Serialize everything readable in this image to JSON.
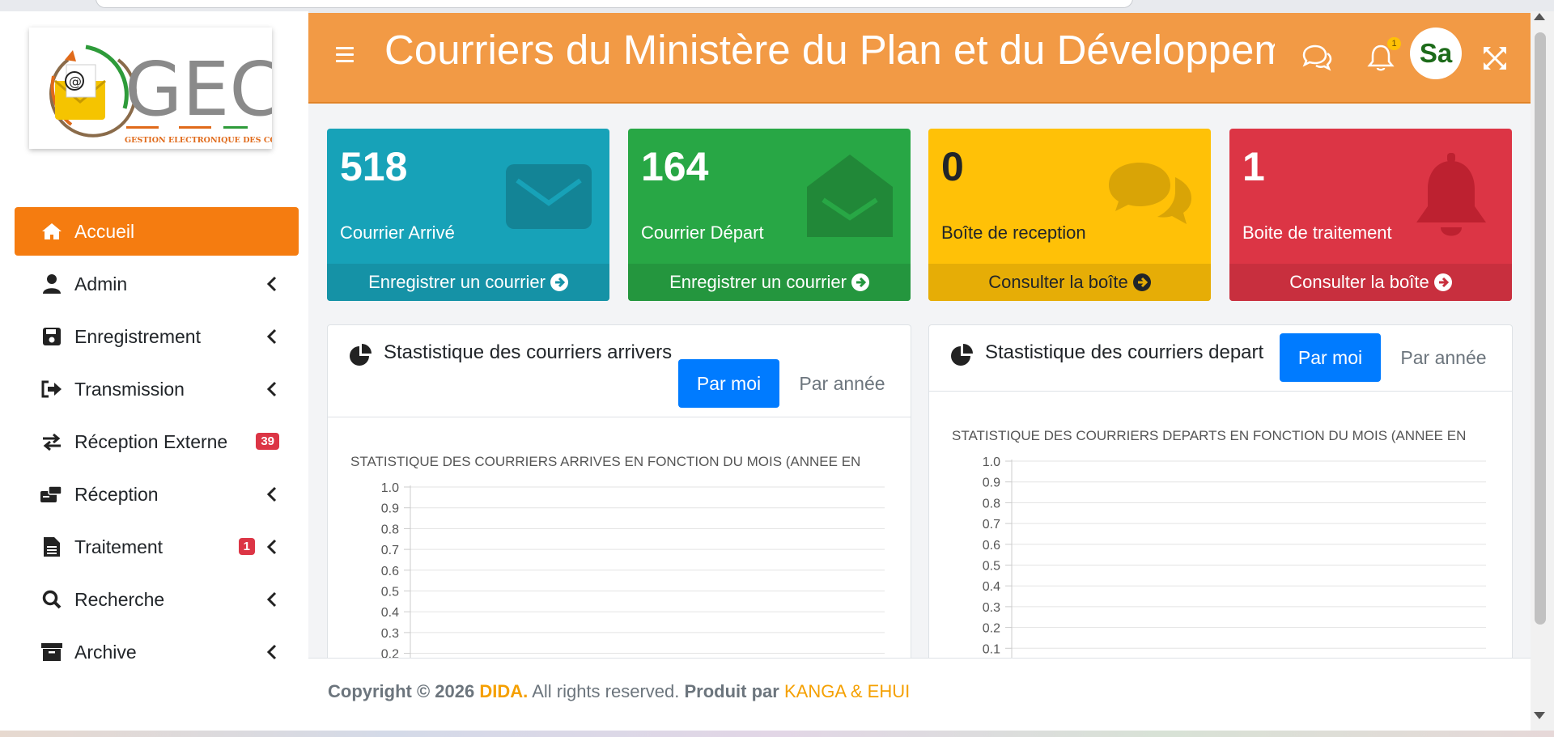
{
  "logo": {
    "name": "GEC",
    "tagline": "GESTION ELECTRONIQUE DES COURRIERS"
  },
  "header": {
    "title": "Courriers du Ministère du Plan et du Développement",
    "notif_count": "1",
    "avatar": "Sa"
  },
  "sidebar": {
    "items": [
      {
        "label": "Accueil",
        "icon": "home-icon",
        "active": true
      },
      {
        "label": "Admin",
        "icon": "user-icon"
      },
      {
        "label": "Enregistrement",
        "icon": "save-icon"
      },
      {
        "label": "Transmission",
        "icon": "sign-out-icon"
      },
      {
        "label": "Réception Externe",
        "icon": "exchange-icon",
        "badge": "39"
      },
      {
        "label": "Réception",
        "icon": "inbox-icon"
      },
      {
        "label": "Traitement",
        "icon": "file-icon",
        "badge": "1"
      },
      {
        "label": "Recherche",
        "icon": "search-icon"
      },
      {
        "label": "Archive",
        "icon": "archive-icon"
      }
    ]
  },
  "cards": [
    {
      "value": "518",
      "label": "Courrier Arrivé",
      "link": "Enregistrer un courrier",
      "icon": "envelope-icon",
      "color": "#17a2b8"
    },
    {
      "value": "164",
      "label": "Courrier Départ",
      "link": "Enregistrer un courrier",
      "icon": "envelope-open-icon",
      "color": "#28a745"
    },
    {
      "value": "0",
      "label": "Boîte de reception",
      "link": "Consulter la boîte",
      "icon": "comments-icon",
      "color": "#ffc107"
    },
    {
      "value": "1",
      "label": "Boite de traitement",
      "link": "Consulter la boîte",
      "icon": "bell-icon",
      "color": "#dc3545"
    }
  ],
  "panels": {
    "arrivals": {
      "title": "Stastistique des courriers arrivers",
      "btn_month": "Par moi",
      "btn_year": "Par année"
    },
    "departs": {
      "title": "Stastistique des courriers depart",
      "btn_month": "Par moi",
      "btn_year": "Par année"
    }
  },
  "chart_data": [
    {
      "type": "line",
      "title": "STATISTIQUE DES COURRIERS ARRIVES EN FONCTION DU MOIS (ANNEE EN",
      "yticks": [
        "1.0",
        "0.9",
        "0.8",
        "0.7",
        "0.6",
        "0.5",
        "0.4",
        "0.3",
        "0.2"
      ],
      "ylim": [
        0,
        1
      ],
      "series": [],
      "grid": true
    },
    {
      "type": "line",
      "title": "STATISTIQUE DES COURRIERS DEPARTS EN FONCTION DU MOIS (ANNEE EN",
      "yticks": [
        "1.0",
        "0.9",
        "0.8",
        "0.7",
        "0.6",
        "0.5",
        "0.4",
        "0.3",
        "0.2",
        "0.1"
      ],
      "ylim": [
        0,
        1
      ],
      "series": [],
      "grid": true
    }
  ],
  "footer": {
    "prefix": "Copyright © 2026",
    "brand": "DIDA.",
    "rights": "All rights reserved.",
    "by": "Produit par",
    "authors": "KANGA & EHUI"
  }
}
